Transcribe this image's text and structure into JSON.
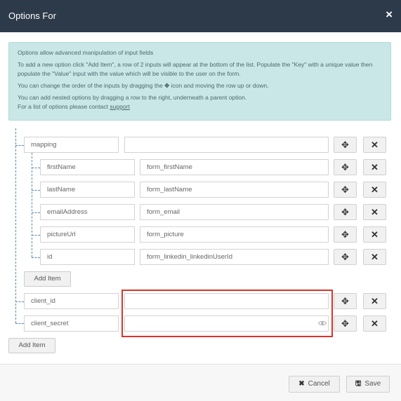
{
  "modal": {
    "title": "Options For",
    "close_icon": "×"
  },
  "info": {
    "line1": "Options allow advanced manipulation of input fields",
    "line2": "To add a new option click \"Add Item\", a row of 2 inputs will appear at the bottom of the list. Populate the \"Key\" with a unique value then populate the \"Value\" input with the value which will be visible to the user on the form.",
    "line3_pre": "You can change the order of the inputs by dragging the",
    "line3_icon": "✥",
    "line3_post": "icon and moving the row up or down.",
    "line4": "You can add nested options by dragging a row to the right, underneath a parent option.",
    "line5_pre": "For a list of options please contact",
    "line5_link": "support"
  },
  "rows": {
    "mapping": {
      "key": "mapping",
      "value": ""
    },
    "firstName": {
      "key": "firstName",
      "value": "form_firstName"
    },
    "lastName": {
      "key": "lastName",
      "value": "form_lastName"
    },
    "emailAddress": {
      "key": "emailAddress",
      "value": "form_email"
    },
    "pictureUrl": {
      "key": "pictureUrl",
      "value": "form_picture"
    },
    "id": {
      "key": "id",
      "value": "form_linkedin_linkedinUserId"
    },
    "client_id": {
      "key": "client_id",
      "value": ""
    },
    "client_secret": {
      "key": "client_secret",
      "value": ""
    }
  },
  "icons": {
    "move": "✥",
    "remove": "✕",
    "eye": "eye-icon"
  },
  "buttons": {
    "add_item_nested": "Add Item",
    "add_item": "Add Item",
    "cancel": "Cancel",
    "cancel_icon": "✖",
    "save": "Save",
    "save_icon": "🖫"
  },
  "colors": {
    "header_bg": "#2d3a4a",
    "info_bg": "#c9e7e6",
    "highlight": "#d9342b",
    "tree_line": "#5a8ab0"
  }
}
